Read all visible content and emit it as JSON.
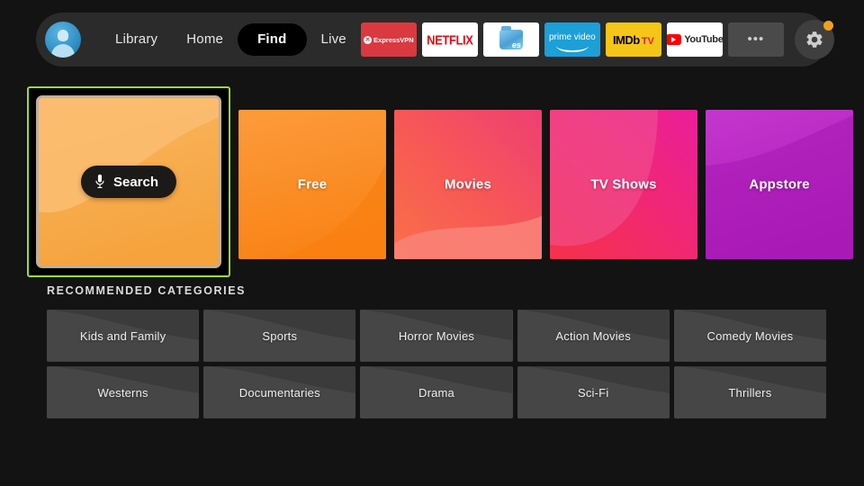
{
  "nav": {
    "avatar": "profile-avatar",
    "links": [
      {
        "label": "Library",
        "active": false
      },
      {
        "label": "Home",
        "active": false
      },
      {
        "label": "Find",
        "active": true
      },
      {
        "label": "Live",
        "active": false
      }
    ],
    "apps": [
      {
        "name": "ExpressVPN",
        "label": "ExpressVPN",
        "badge": "x",
        "bg": "#da3940"
      },
      {
        "name": "Netflix",
        "label": "NETFLIX",
        "bg": "#ffffff"
      },
      {
        "name": "ES File Explorer",
        "label": "es",
        "bg": "#ffffff"
      },
      {
        "name": "Prime Video",
        "label": "prime video",
        "bg": "#1d9fd7"
      },
      {
        "name": "IMDb TV",
        "label": "IMDb",
        "label2": "TV",
        "bg": "#f5c518"
      },
      {
        "name": "YouTube",
        "label": "YouTube",
        "bg": "#ffffff"
      },
      {
        "name": "More",
        "label": "•••",
        "bg": "#4a4a4a"
      }
    ],
    "settings": {
      "icon": "gear-icon",
      "badge_color": "#f0a020"
    }
  },
  "tiles": [
    {
      "label": "Search",
      "focused": true,
      "icon": "microphone-icon",
      "color_from": "#f9b55a",
      "color_to": "#f39a30"
    },
    {
      "label": "Free",
      "focused": false,
      "color_from": "#fb9132",
      "color_to": "#f97a16"
    },
    {
      "label": "Movies",
      "focused": false,
      "color_from": "#f2516b",
      "color_to": "#fa6a4b"
    },
    {
      "label": "TV Shows",
      "focused": false,
      "color_from": "#e8318c",
      "color_to": "#f42f56"
    },
    {
      "label": "Appstore",
      "focused": false,
      "color_from": "#c02fc7",
      "color_to": "#a91bb5"
    }
  ],
  "recommended": {
    "title": "RECOMMENDED CATEGORIES",
    "categories": [
      "Kids and Family",
      "Sports",
      "Horror Movies",
      "Action Movies",
      "Comedy Movies",
      "Westerns",
      "Documentaries",
      "Drama",
      "Sci-Fi",
      "Thrillers"
    ]
  },
  "theme": {
    "background": "#131313",
    "navbar": "#2b2b2b",
    "focus_ring": "#9ddc2a",
    "tile_label": "#ffffff",
    "category_bg": "#434343"
  }
}
